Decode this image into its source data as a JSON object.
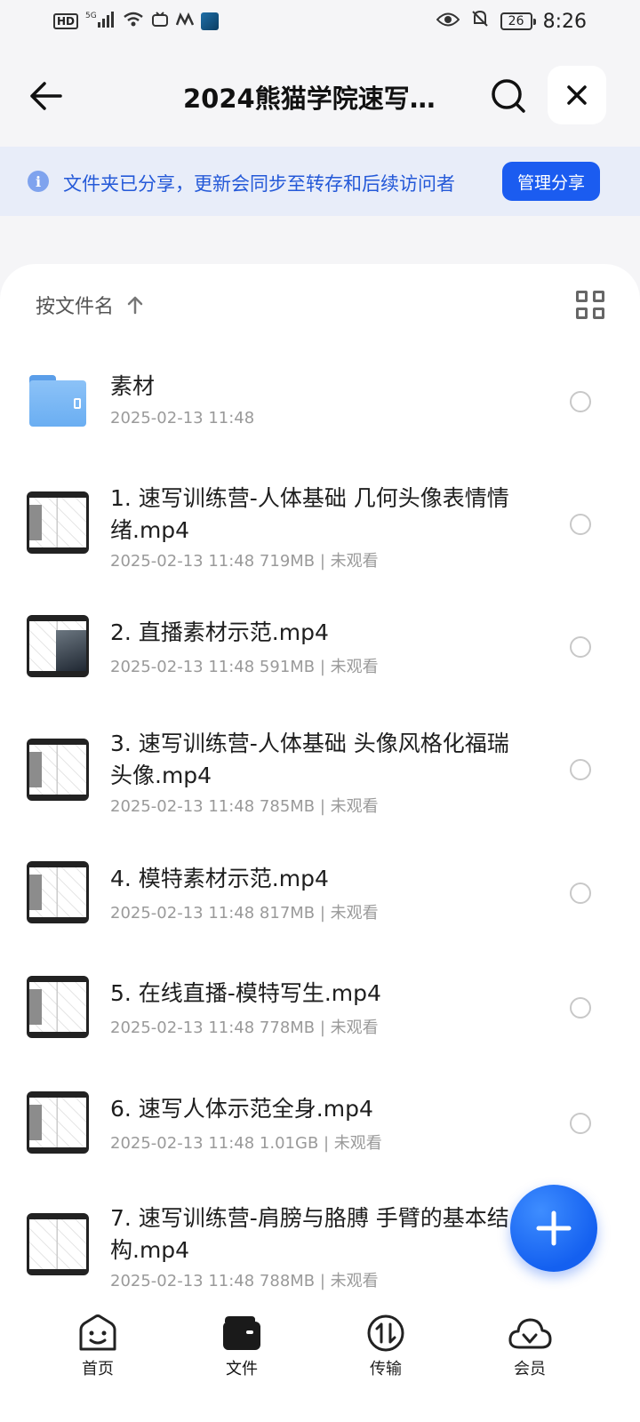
{
  "status_bar": {
    "left_badges": [
      "HD",
      "5G"
    ],
    "battery": "26",
    "time": "8:26"
  },
  "header": {
    "title": "2024熊猫学院速写…",
    "back_icon": "arrow-left-icon",
    "search_icon": "search-icon",
    "close_icon": "close-icon"
  },
  "share_banner": {
    "text": "文件夹已分享，更新会同步至转存和后续访问者",
    "button": "管理分享"
  },
  "sort": {
    "label": "按文件名",
    "direction_icon": "arrow-up-icon",
    "view_icon": "grid-view-icon"
  },
  "files": [
    {
      "name": "素材",
      "meta": "2025-02-13 11:48",
      "kind": "folder"
    },
    {
      "name": "1. 速写训练营-人体基础 几何头像表情情绪.mp4",
      "meta": "2025-02-13 11:48  719MB | 未观看",
      "kind": "video"
    },
    {
      "name": "2. 直播素材示范.mp4",
      "meta": "2025-02-13 11:48  591MB | 未观看",
      "kind": "video"
    },
    {
      "name": "3. 速写训练营-人体基础 头像风格化福瑞头像.mp4",
      "meta": "2025-02-13 11:48  785MB | 未观看",
      "kind": "video"
    },
    {
      "name": "4. 模特素材示范.mp4",
      "meta": "2025-02-13 11:48  817MB | 未观看",
      "kind": "video"
    },
    {
      "name": "5. 在线直播-模特写生.mp4",
      "meta": "2025-02-13 11:48  778MB | 未观看",
      "kind": "video"
    },
    {
      "name": "6. 速写人体示范全身.mp4",
      "meta": "2025-02-13 11:48  1.01GB | 未观看",
      "kind": "video"
    },
    {
      "name": "7. 速写训练营-肩膀与胳膊 手臂的基本结构.mp4",
      "meta": "2025-02-13 11:48  788MB | 未观看",
      "kind": "video"
    }
  ],
  "bottom_nav": [
    {
      "label": "首页",
      "icon": "home-smile-icon"
    },
    {
      "label": "文件",
      "icon": "wallet-folder-icon"
    },
    {
      "label": "传输",
      "icon": "transfer-icon"
    },
    {
      "label": "会员",
      "icon": "cloud-vip-icon"
    }
  ],
  "colors": {
    "accent": "#1b5cf0",
    "banner_bg": "#e8edf9",
    "banner_text": "#2459d8"
  }
}
